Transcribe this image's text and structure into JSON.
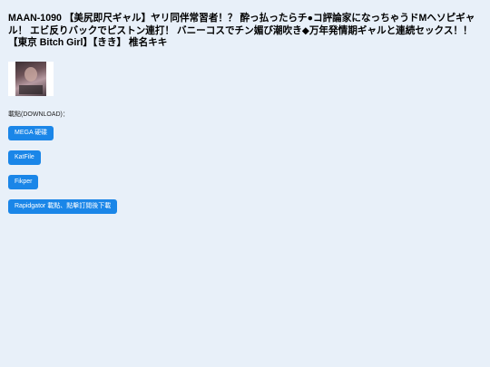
{
  "page": {
    "title": "MAAN-1090 【美尻即尺ギャル】ヤリ同伴常習者！？ 酔っ払ったらチ●コ評論家になっちゃうドMヘソピギャル！ エビ反りバックでピストン連打！ バニーコスでチン媚び潮吹き◆万年発情期ギャルと連続セックス！！ 【東京 Bitch Girl】【きき】 椎名キキ"
  },
  "thumbnail": {
    "alt": "cover image"
  },
  "download": {
    "label": "載點(DOWNLOAD)：",
    "buttons": [
      {
        "label": "MEGA 硬碟"
      },
      {
        "label": "KatFile"
      },
      {
        "label": "Fikper"
      },
      {
        "label": "Rapidgator 載點、點擊訂閱後下載"
      }
    ]
  },
  "colors": {
    "background": "#e8f0f9",
    "button": "#1a86e8",
    "button_text": "#ffffff"
  }
}
